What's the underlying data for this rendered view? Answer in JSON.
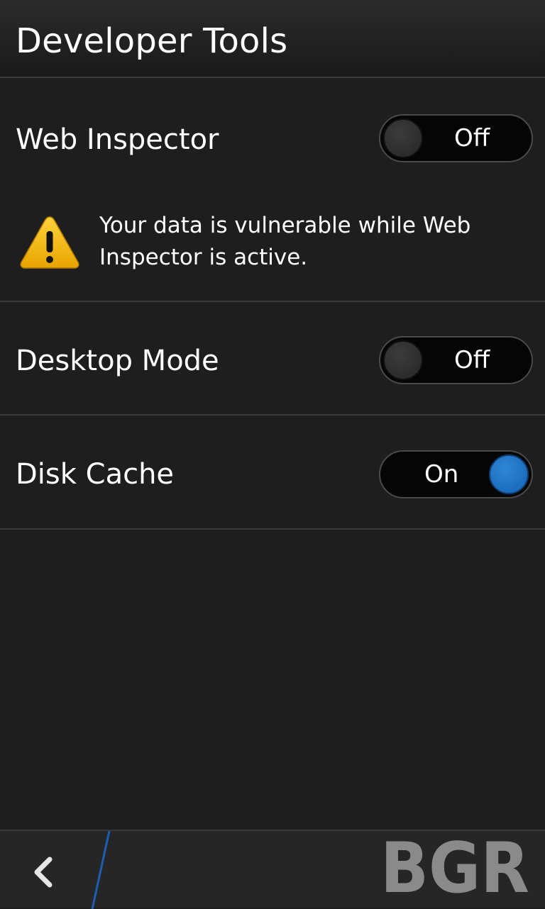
{
  "header": {
    "title": "Developer Tools"
  },
  "settings": [
    {
      "label": "Web Inspector",
      "state": "Off",
      "enabled": false
    },
    {
      "label": "Desktop Mode",
      "state": "Off",
      "enabled": false
    },
    {
      "label": "Disk Cache",
      "state": "On",
      "enabled": true
    }
  ],
  "warning": {
    "icon": "warning-triangle-icon",
    "text": "Your data is vulnerable while Web Inspector is active."
  },
  "action_bar": {
    "back_icon": "chevron-left-icon",
    "accent_color": "#1a5fb4"
  },
  "watermark": {
    "text": "BGR",
    "color": "#8a8a8a"
  },
  "colors": {
    "background": "#1e1e1e",
    "toggle_on_knob": "#1f72c6",
    "warning_yellow": "#f0b400"
  }
}
